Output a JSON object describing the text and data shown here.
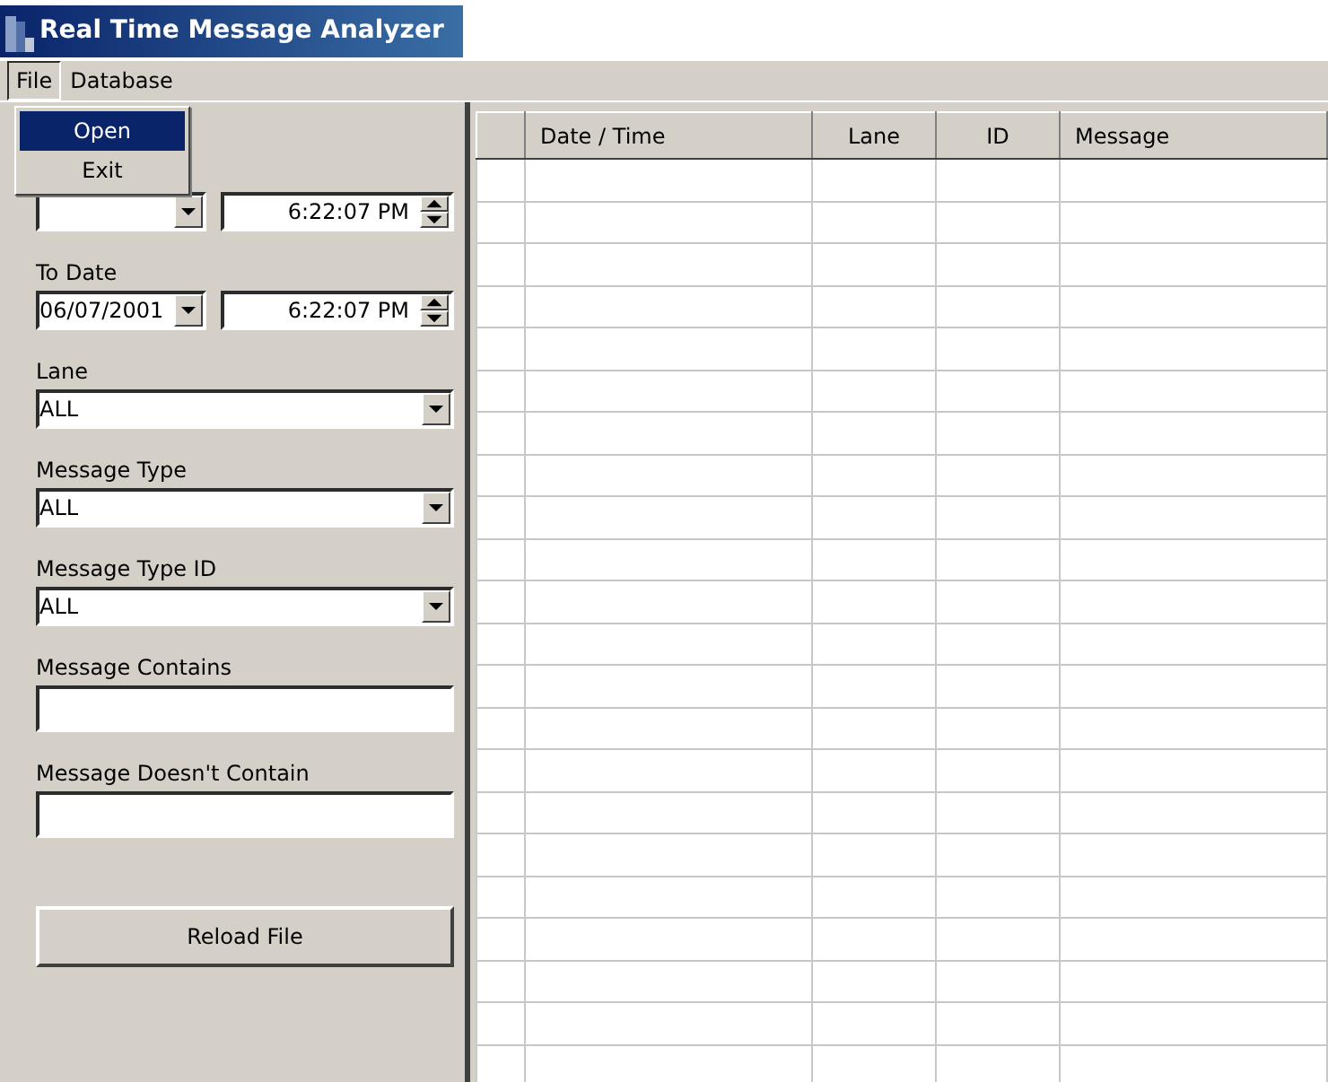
{
  "window": {
    "title": "Real Time Message Analyzer"
  },
  "menu": [
    {
      "label": "File",
      "selected": true
    },
    {
      "label": "Database",
      "selected": false
    }
  ],
  "open_menu": {
    "items": [
      {
        "label": "Open",
        "selected": true
      },
      {
        "label": "Exit",
        "selected": false
      }
    ]
  },
  "filters": [
    {
      "kind": "datetime",
      "time": "6:22:07 PM"
    },
    {
      "kind": "datetime",
      "label": "To Date",
      "date": "06/07/2001",
      "time": "6:22:07 PM"
    },
    {
      "kind": "combo",
      "label": "Lane",
      "value": "ALL"
    },
    {
      "kind": "combo",
      "label": "Message Type",
      "value": "ALL"
    },
    {
      "kind": "combo",
      "label": "Message Type ID",
      "value": "ALL"
    },
    {
      "kind": "text",
      "label": "Message Contains"
    },
    {
      "kind": "text",
      "label": "Message Doesn't  Contain"
    }
  ],
  "reload_button": "Reload File",
  "grid": {
    "columns": [
      "Date / Time",
      "Lane",
      "ID",
      "Message"
    ]
  }
}
